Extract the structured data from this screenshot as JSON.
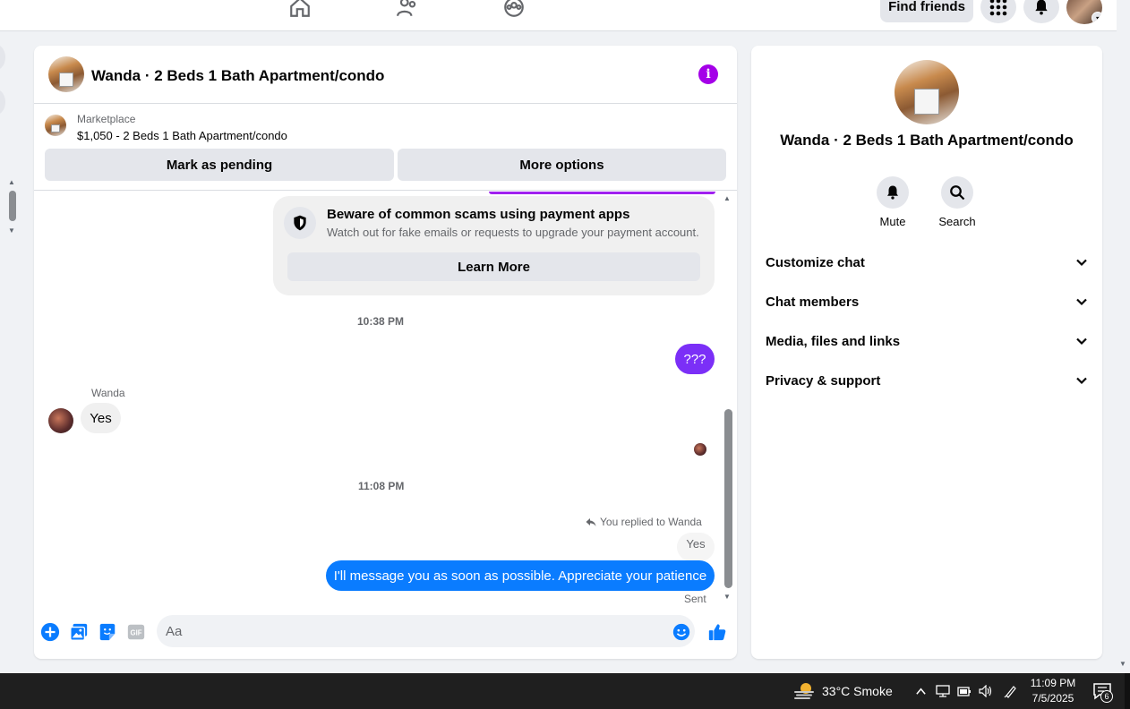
{
  "nav": {
    "icons": [
      "home-icon",
      "friends-icon",
      "groups-icon"
    ],
    "find_friends_label": "Find friends",
    "menu_icon": "grid-menu-icon",
    "notifications_icon": "bell-icon",
    "account_icon": "account-avatar"
  },
  "chat": {
    "title": "Wanda · 2 Beds 1 Bath Apartment/condo",
    "marketplace_label": "Marketplace",
    "listing": "$1,050 - 2 Beds 1 Bath Apartment/condo",
    "mark_pending_label": "Mark as pending",
    "more_options_label": "More options",
    "info_glyph": "i",
    "scam_notice": {
      "title": "Beware of common scams using payment apps",
      "subtitle": "Watch out for fake emails or requests to upgrade your payment account.",
      "button": "Learn More"
    },
    "messages": [
      {
        "type": "timestamp",
        "text": "10:38 PM"
      },
      {
        "type": "outgoing",
        "text": "???"
      },
      {
        "type": "sender",
        "text": "Wanda"
      },
      {
        "type": "incoming",
        "text": "Yes"
      },
      {
        "type": "timestamp",
        "text": "11:08 PM"
      },
      {
        "type": "reply_note",
        "text": "You replied to Wanda"
      },
      {
        "type": "quoted",
        "text": "Yes"
      },
      {
        "type": "outgoing",
        "text": "I'll message you as soon as possible. Appreciate your patience"
      },
      {
        "type": "status",
        "text": "Sent"
      }
    ],
    "composer": {
      "placeholder": "Aa",
      "gif_label": "GIF"
    }
  },
  "details": {
    "title": "Wanda · 2 Beds 1 Bath Apartment/condo",
    "actions": [
      {
        "label": "Mute",
        "icon": "bell-icon"
      },
      {
        "label": "Search",
        "icon": "search-icon"
      }
    ],
    "sections": [
      "Customize chat",
      "Chat members",
      "Media, files and links",
      "Privacy & support"
    ]
  },
  "taskbar": {
    "weather": "33°C  Smoke",
    "time": "11:09 PM",
    "date": "7/5/2025",
    "notification_count": "6"
  },
  "colors": {
    "accent_blue": "#0a7cff",
    "accent_purple": "#7b2ff7",
    "info_purple": "#a400e8"
  }
}
